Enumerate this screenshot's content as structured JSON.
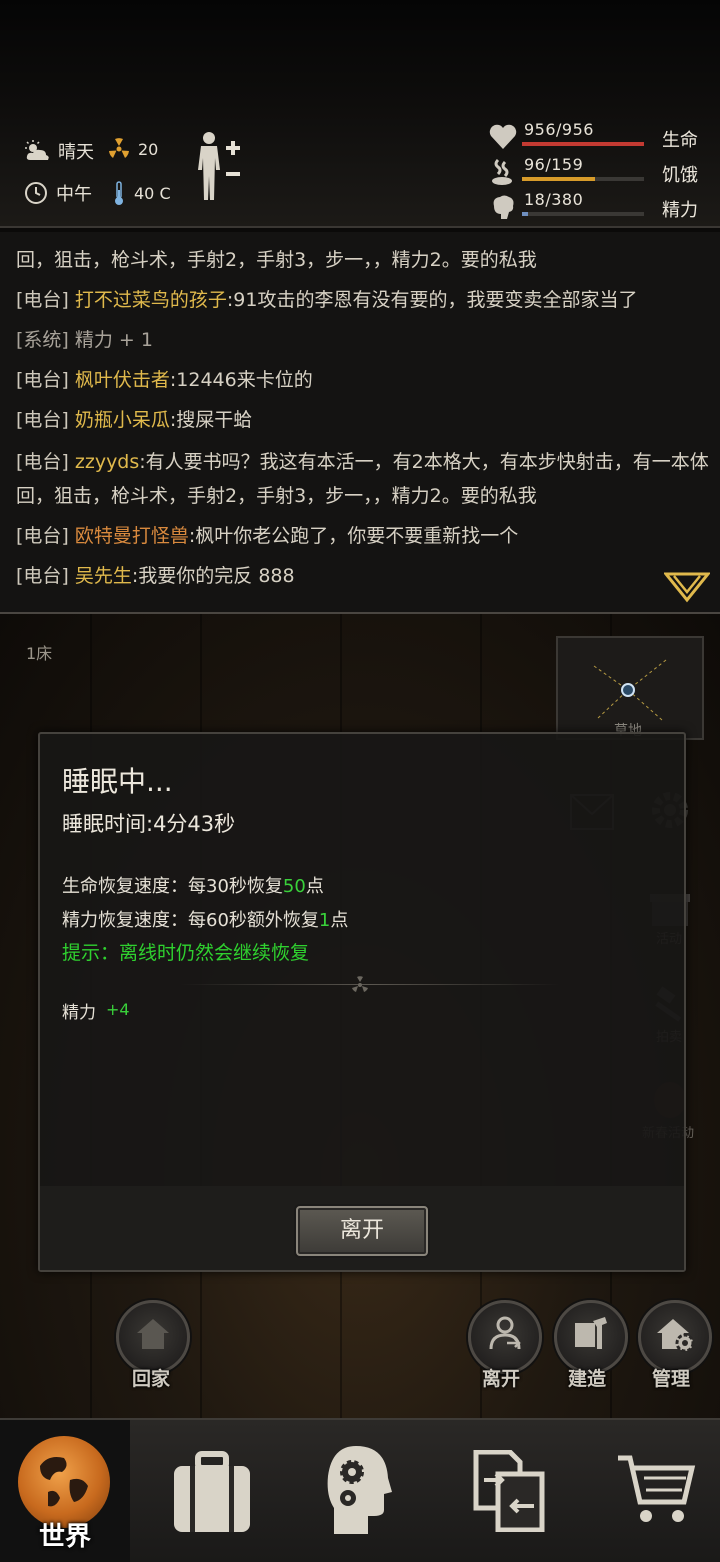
{
  "hud": {
    "weather": "晴天",
    "radiation": "20",
    "time_of_day": "中午",
    "temperature": "40 C",
    "stats": [
      {
        "value": "956/956",
        "name": "生命",
        "fraction": 1.0,
        "color": "#c33a32"
      },
      {
        "value": "96/159",
        "name": "饥饿",
        "fraction": 0.6,
        "color": "#d79b2a"
      },
      {
        "value": "18/380",
        "name": "精力",
        "fraction": 0.05,
        "color": "#6f8fbf"
      }
    ]
  },
  "chat": {
    "lines": [
      {
        "tag": "",
        "nick": "",
        "text": "回，狙击，枪斗术，手射2，手射3，步一，，精力2。要的私我"
      },
      {
        "tag": "[电台]",
        "nick": "打不过菜鸟的孩子",
        "text": ":91攻击的李恩有没有要的，我要变卖全部家当了"
      },
      {
        "tag": "[系统]",
        "nick": "",
        "text": "精力 + 1"
      },
      {
        "tag": "[电台]",
        "nick": "枫叶伏击者",
        "text": ":12446来卡位的"
      },
      {
        "tag": "[电台]",
        "nick": "奶瓶小呆瓜",
        "text": ":搜屎干蛤"
      },
      {
        "tag": "[电台]",
        "nick": "zzyyds",
        "text": ":有人要书吗？我这有本活一，有2本格大，有本步快射击，有一本体"
      },
      {
        "tag": "",
        "nick": "",
        "text": "回，狙击，枪斗术，手射2，手射3，步一，，精力2。要的私我"
      },
      {
        "tag": "[电台]",
        "nick": "欧特曼打怪兽",
        "text": ":枫叶你老公跑了，你要不要重新找一个"
      },
      {
        "tag": "[电台]",
        "nick": "吴先生",
        "text": ":我要你的完反 888"
      }
    ]
  },
  "scene": {
    "bed_label": "1床",
    "minimap_label": "草地",
    "side_labels": {
      "activity": "活动",
      "auction": "拍卖",
      "new_year": "新春活动"
    },
    "buttons": {
      "home": "回家",
      "leave": "离开",
      "build": "建造",
      "manage": "管理"
    }
  },
  "modal": {
    "title": "睡眠中...",
    "sleep_time": "睡眠时间:4分43秒",
    "hp_rate_prefix": "生命恢复速度：每30秒恢复",
    "hp_rate_num": "50",
    "hp_rate_suffix": "点",
    "energy_rate_prefix": "精力恢复速度：每60秒额外恢复",
    "energy_rate_num": "1",
    "energy_rate_suffix": "点",
    "hint": "提示：离线时仍然会继续恢复",
    "gain_label": "精力",
    "gain_value": "+4",
    "leave_button": "离开"
  },
  "bottom_nav": {
    "world": "世界"
  },
  "colors": {
    "hint_green": "#2fd12f",
    "nick_gold": "#e0b94c",
    "nick_orange": "#d98a3e"
  }
}
